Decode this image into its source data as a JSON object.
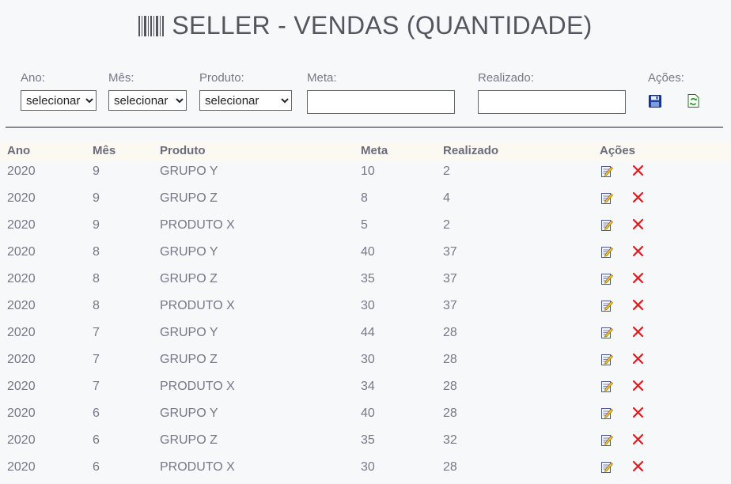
{
  "header": {
    "title": "SELLER - VENDAS (QUANTIDADE)",
    "icon": "barcode-icon"
  },
  "filters": {
    "ano": {
      "label": "Ano:",
      "value": "selecionar"
    },
    "mes": {
      "label": "Mês:",
      "value": "selecionar"
    },
    "produto": {
      "label": "Produto:",
      "value": "selecionar"
    },
    "meta": {
      "label": "Meta:",
      "value": ""
    },
    "realizado": {
      "label": "Realizado:",
      "value": ""
    },
    "acoes": {
      "label": "Ações:",
      "save_icon": "save-icon",
      "refresh_icon": "refresh-icon"
    }
  },
  "table": {
    "columns": [
      "Ano",
      "Mês",
      "Produto",
      "Meta",
      "Realizado",
      "Ações"
    ],
    "rows": [
      [
        "2020",
        "9",
        "GRUPO Y",
        "10",
        "2"
      ],
      [
        "2020",
        "9",
        "GRUPO Z",
        "8",
        "4"
      ],
      [
        "2020",
        "9",
        "PRODUTO X",
        "5",
        "2"
      ],
      [
        "2020",
        "8",
        "GRUPO Y",
        "40",
        "37"
      ],
      [
        "2020",
        "8",
        "GRUPO Z",
        "35",
        "37"
      ],
      [
        "2020",
        "8",
        "PRODUTO X",
        "30",
        "37"
      ],
      [
        "2020",
        "7",
        "GRUPO Y",
        "44",
        "28"
      ],
      [
        "2020",
        "7",
        "GRUPO Z",
        "30",
        "28"
      ],
      [
        "2020",
        "7",
        "PRODUTO X",
        "34",
        "28"
      ],
      [
        "2020",
        "6",
        "GRUPO Y",
        "40",
        "28"
      ],
      [
        "2020",
        "6",
        "GRUPO Z",
        "35",
        "32"
      ],
      [
        "2020",
        "6",
        "PRODUTO X",
        "30",
        "28"
      ]
    ],
    "row_icons": {
      "edit": "edit-icon",
      "delete": "delete-icon"
    }
  },
  "colors": {
    "title": "#55555f",
    "text": "#77778a",
    "divider": "#8a8a95",
    "delete": "#d62020",
    "save": "#1f3fa0",
    "refresh": "#2a9a2a"
  }
}
